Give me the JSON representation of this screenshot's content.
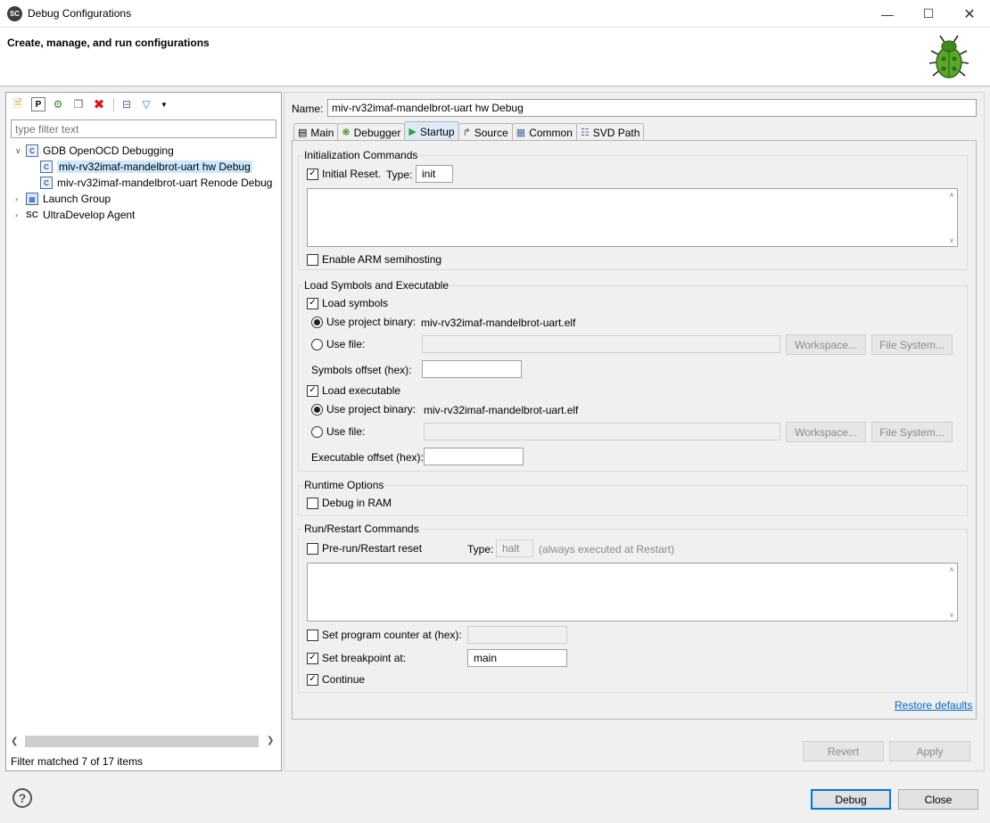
{
  "window": {
    "title": "Debug Configurations",
    "app_icon_text": "SC",
    "header_title": "Create, manage, and run configurations"
  },
  "left": {
    "filter_placeholder": "type filter text",
    "tree": [
      {
        "label": "GDB OpenOCD Debugging",
        "expanded": true,
        "level": 0
      },
      {
        "label": "miv-rv32imaf-mandelbrot-uart hw Debug",
        "level": 1,
        "selected": true
      },
      {
        "label": "miv-rv32imaf-mandelbrot-uart Renode Debug",
        "level": 1
      },
      {
        "label": "Launch Group",
        "expanded": false,
        "level": 0
      },
      {
        "label": "UltraDevelop Agent",
        "expanded": false,
        "level": 0
      }
    ],
    "status": "Filter matched 7 of 17 items"
  },
  "right": {
    "name_label": "Name:",
    "name_value": "miv-rv32imaf-mandelbrot-uart hw Debug",
    "tabs": [
      {
        "label": "Main",
        "icon": "main-icon"
      },
      {
        "label": "Debugger",
        "icon": "bug-icon"
      },
      {
        "label": "Startup",
        "icon": "play-icon",
        "active": true
      },
      {
        "label": "Source",
        "icon": "source-icon"
      },
      {
        "label": "Common",
        "icon": "common-icon"
      },
      {
        "label": "SVD Path",
        "icon": "tree-icon"
      }
    ],
    "init": {
      "title": "Initialization Commands",
      "initial_reset_label": "Initial Reset.",
      "initial_reset_checked": true,
      "type_label": "Type:",
      "type_value": "init",
      "semihosting_label": "Enable ARM semihosting",
      "semihosting_checked": false
    },
    "load": {
      "title": "Load Symbols and Executable",
      "load_symbols_label": "Load symbols",
      "load_symbols_checked": true,
      "use_project_binary_label": "Use project binary:",
      "symbols_binary": "miv-rv32imaf-mandelbrot-uart.elf",
      "use_file_label": "Use file:",
      "workspace_label": "Workspace...",
      "filesystem_label": "File System...",
      "symbols_offset_label": "Symbols offset (hex):",
      "load_executable_label": "Load executable",
      "load_executable_checked": true,
      "executable_binary": "miv-rv32imaf-mandelbrot-uart.elf",
      "executable_offset_label": "Executable offset (hex):"
    },
    "runtime": {
      "title": "Runtime Options",
      "debug_in_ram_label": "Debug in RAM",
      "debug_in_ram_checked": false
    },
    "run": {
      "title": "Run/Restart Commands",
      "prerun_label": "Pre-run/Restart reset",
      "prerun_checked": false,
      "type_label": "Type:",
      "type_value": "halt",
      "type_hint": "(always executed at Restart)",
      "set_pc_label": "Set program counter at (hex):",
      "set_pc_checked": false,
      "set_bp_label": "Set breakpoint at:",
      "set_bp_checked": true,
      "bp_value": "main",
      "continue_label": "Continue",
      "continue_checked": true
    },
    "restore_defaults": "Restore defaults",
    "revert_label": "Revert",
    "apply_label": "Apply"
  },
  "footer": {
    "help_icon": "?",
    "debug_label": "Debug",
    "close_label": "Close"
  },
  "check_mark": "✓"
}
